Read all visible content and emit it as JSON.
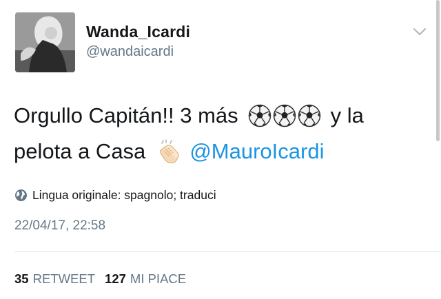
{
  "user": {
    "display_name": "Wanda_Icardi",
    "handle": "@wandaicardi"
  },
  "tweet": {
    "line1_text": "Orgullo Capitán!! 3 más",
    "line1_after": "y la",
    "line2_text": "pelota a Casa",
    "mention": "@MauroIcardi",
    "emoji": [
      "soccer-ball",
      "soccer-ball",
      "soccer-ball",
      "clapping-hands"
    ]
  },
  "translation": {
    "label": "Lingua originale: spagnolo; traduci"
  },
  "timestamp": "22/04/17, 22:58",
  "stats": {
    "retweets_count": "35",
    "retweets_label": "RETWEET",
    "likes_count": "127",
    "likes_label": "MI PIACE"
  },
  "icons": {
    "avatar": "avatar",
    "menu": "chevron-down-icon",
    "globe": "globe-icon"
  },
  "colors": {
    "text": "#14171a",
    "secondary": "#657786",
    "link": "#1b95e0",
    "divider": "#e1e8ed"
  }
}
